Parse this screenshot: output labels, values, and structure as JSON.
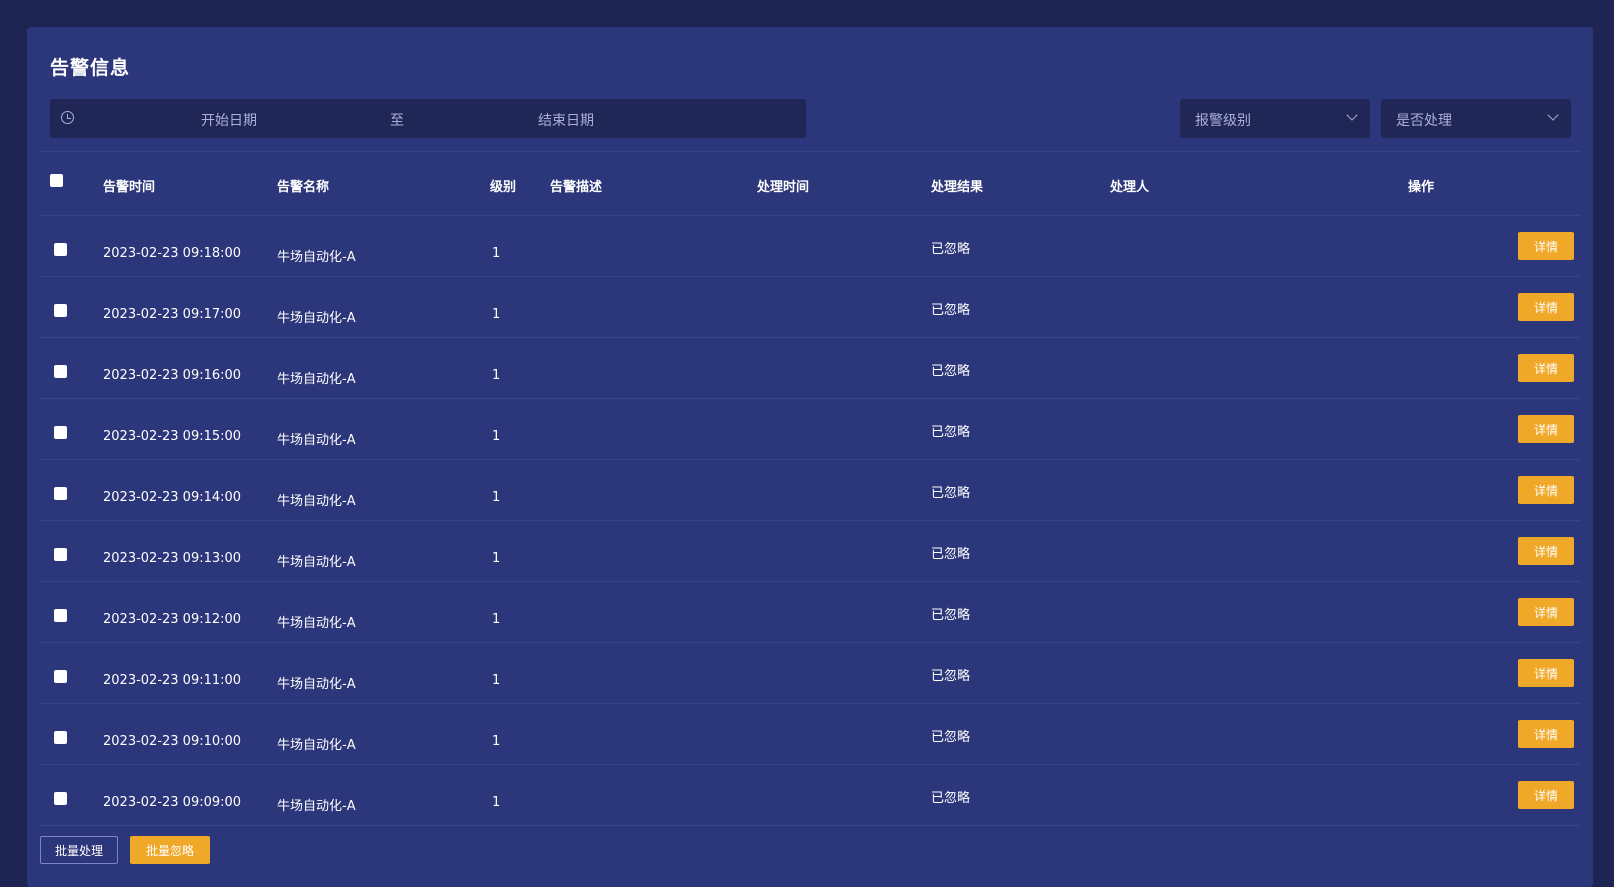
{
  "page": {
    "title": "告警信息"
  },
  "filters": {
    "start_placeholder": "开始日期",
    "separator": "至",
    "end_placeholder": "结束日期",
    "level_placeholder": "报警级别",
    "handled_placeholder": "是否处理"
  },
  "table": {
    "headers": {
      "time": "告警时间",
      "name": "告警名称",
      "level": "级别",
      "description": "告警描述",
      "handle_time": "处理时间",
      "result": "处理结果",
      "handler": "处理人",
      "action": "操作"
    },
    "rows": [
      {
        "time": "2023-02-23 09:18:00",
        "name": "牛场自动化-A",
        "level": "1",
        "description": "",
        "handle_time": "",
        "result": "已忽略",
        "handler": "",
        "action": "详情"
      },
      {
        "time": "2023-02-23 09:17:00",
        "name": "牛场自动化-A",
        "level": "1",
        "description": "",
        "handle_time": "",
        "result": "已忽略",
        "handler": "",
        "action": "详情"
      },
      {
        "time": "2023-02-23 09:16:00",
        "name": "牛场自动化-A",
        "level": "1",
        "description": "",
        "handle_time": "",
        "result": "已忽略",
        "handler": "",
        "action": "详情"
      },
      {
        "time": "2023-02-23 09:15:00",
        "name": "牛场自动化-A",
        "level": "1",
        "description": "",
        "handle_time": "",
        "result": "已忽略",
        "handler": "",
        "action": "详情"
      },
      {
        "time": "2023-02-23 09:14:00",
        "name": "牛场自动化-A",
        "level": "1",
        "description": "",
        "handle_time": "",
        "result": "已忽略",
        "handler": "",
        "action": "详情"
      },
      {
        "time": "2023-02-23 09:13:00",
        "name": "牛场自动化-A",
        "level": "1",
        "description": "",
        "handle_time": "",
        "result": "已忽略",
        "handler": "",
        "action": "详情"
      },
      {
        "time": "2023-02-23 09:12:00",
        "name": "牛场自动化-A",
        "level": "1",
        "description": "",
        "handle_time": "",
        "result": "已忽略",
        "handler": "",
        "action": "详情"
      },
      {
        "time": "2023-02-23 09:11:00",
        "name": "牛场自动化-A",
        "level": "1",
        "description": "",
        "handle_time": "",
        "result": "已忽略",
        "handler": "",
        "action": "详情"
      },
      {
        "time": "2023-02-23 09:10:00",
        "name": "牛场自动化-A",
        "level": "1",
        "description": "",
        "handle_time": "",
        "result": "已忽略",
        "handler": "",
        "action": "详情"
      },
      {
        "time": "2023-02-23 09:09:00",
        "name": "牛场自动化-A",
        "level": "1",
        "description": "",
        "handle_time": "",
        "result": "已忽略",
        "handler": "",
        "action": "详情"
      }
    ]
  },
  "footer": {
    "batch_process_label": "批量处理",
    "batch_ignore_label": "批量忽略"
  },
  "colors": {
    "background": "#1f2552",
    "panel": "#2c367a",
    "accent": "#f0a829"
  }
}
